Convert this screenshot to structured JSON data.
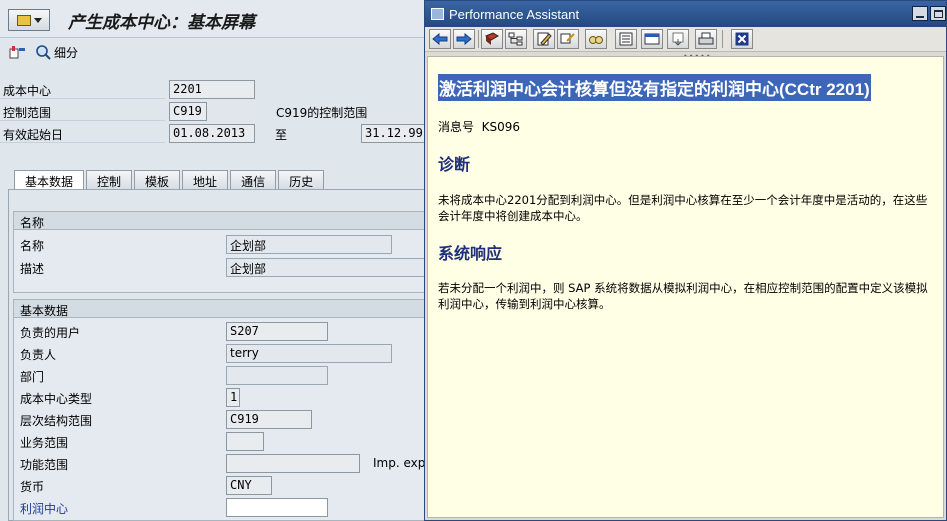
{
  "main": {
    "title": "产生成本中心：基本屏幕",
    "toolbar": {
      "detail_label": "细分"
    },
    "header": {
      "cost_center_label": "成本中心",
      "cost_center_value": "2201",
      "controlling_area_label": "控制范围",
      "controlling_area_value": "C919",
      "controlling_area_desc": "C919的控制范围",
      "valid_from_label": "有效起始日",
      "valid_from_value": "01.08.2013",
      "to_label": "至",
      "valid_to_value": "31.12.99"
    },
    "tabs": [
      "基本数据",
      "控制",
      "模板",
      "地址",
      "通信",
      "历史"
    ],
    "names_group": {
      "title": "名称",
      "name_label": "名称",
      "name_value": "企划部",
      "desc_label": "描述",
      "desc_value": "企划部"
    },
    "basic_group": {
      "title": "基本数据",
      "user_label": "负责的用户",
      "user_value": "S207",
      "person_label": "负责人",
      "person_value": "terry",
      "dept_label": "部门",
      "dept_value": "",
      "cctype_label": "成本中心类型",
      "cctype_value": "1",
      "hier_label": "层次结构范围",
      "hier_value": "C919",
      "busarea_label": "业务范围",
      "busarea_value": "",
      "funcarea_label": "功能范围",
      "funcarea_value": "",
      "imp_label": "Imp. expe",
      "currency_label": "货币",
      "currency_value": "CNY",
      "profit_label": "利润中心",
      "profit_value": ""
    }
  },
  "assistant": {
    "title": "Performance Assistant",
    "heading": "激活利润中心会计核算但没有指定的利润中心(CCtr 2201)",
    "msg_label": "消息号",
    "msg_value": "KS096",
    "diag_title": "诊断",
    "diag_text": "未将成本中心2201分配到利润中心。但是利润中心核算在至少一个会计年度中是活动的，在这些会计年度中将创建成本中心。",
    "resp_title": "系统响应",
    "resp_text": "若未分配一个利润中，则 SAP 系统将数据从模拟利润中心，在相应控制范围的配置中定义该模拟利润中心，传输到利润中心核算。"
  }
}
